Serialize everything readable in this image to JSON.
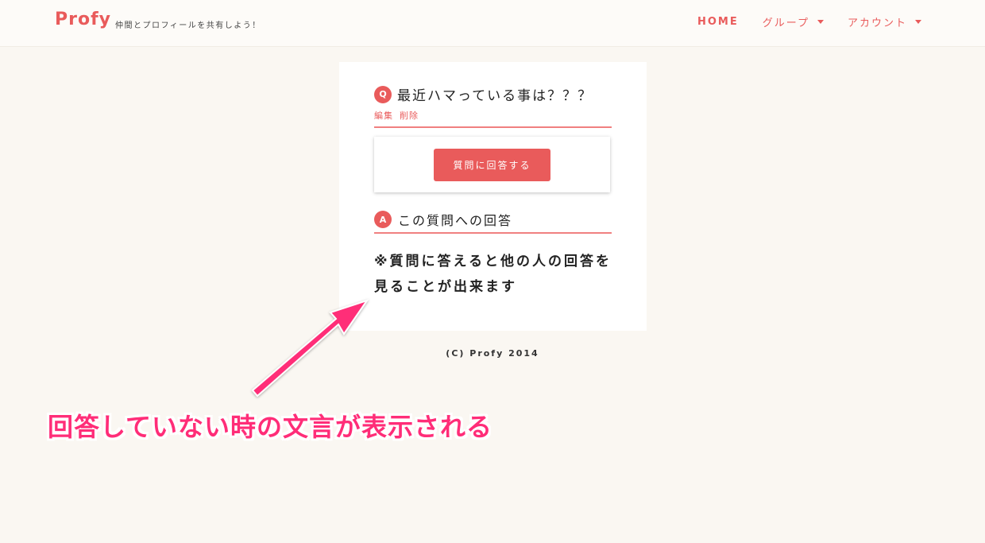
{
  "header": {
    "brand": "Profy",
    "tagline": "仲間とプロフィールを共有しよう！",
    "nav": {
      "home": "HOME",
      "group": "グループ",
      "account": "アカウント"
    }
  },
  "question": {
    "badge": "Q",
    "title": "最近ハマっている事は？？？",
    "edit_label": "編集",
    "delete_label": "削除",
    "answer_button": "質問に回答する"
  },
  "answers": {
    "badge": "A",
    "title": "この質問への回答",
    "notice": "※質問に答えると他の人の回答を見ることが出来ます"
  },
  "footer": {
    "copyright": "(C) Profy 2014"
  },
  "annotation": {
    "text": "回答していない時の文言が表示される"
  },
  "colors": {
    "accent": "#e95b5b",
    "background": "#faf7f2",
    "annotation": "#ff2d78"
  }
}
